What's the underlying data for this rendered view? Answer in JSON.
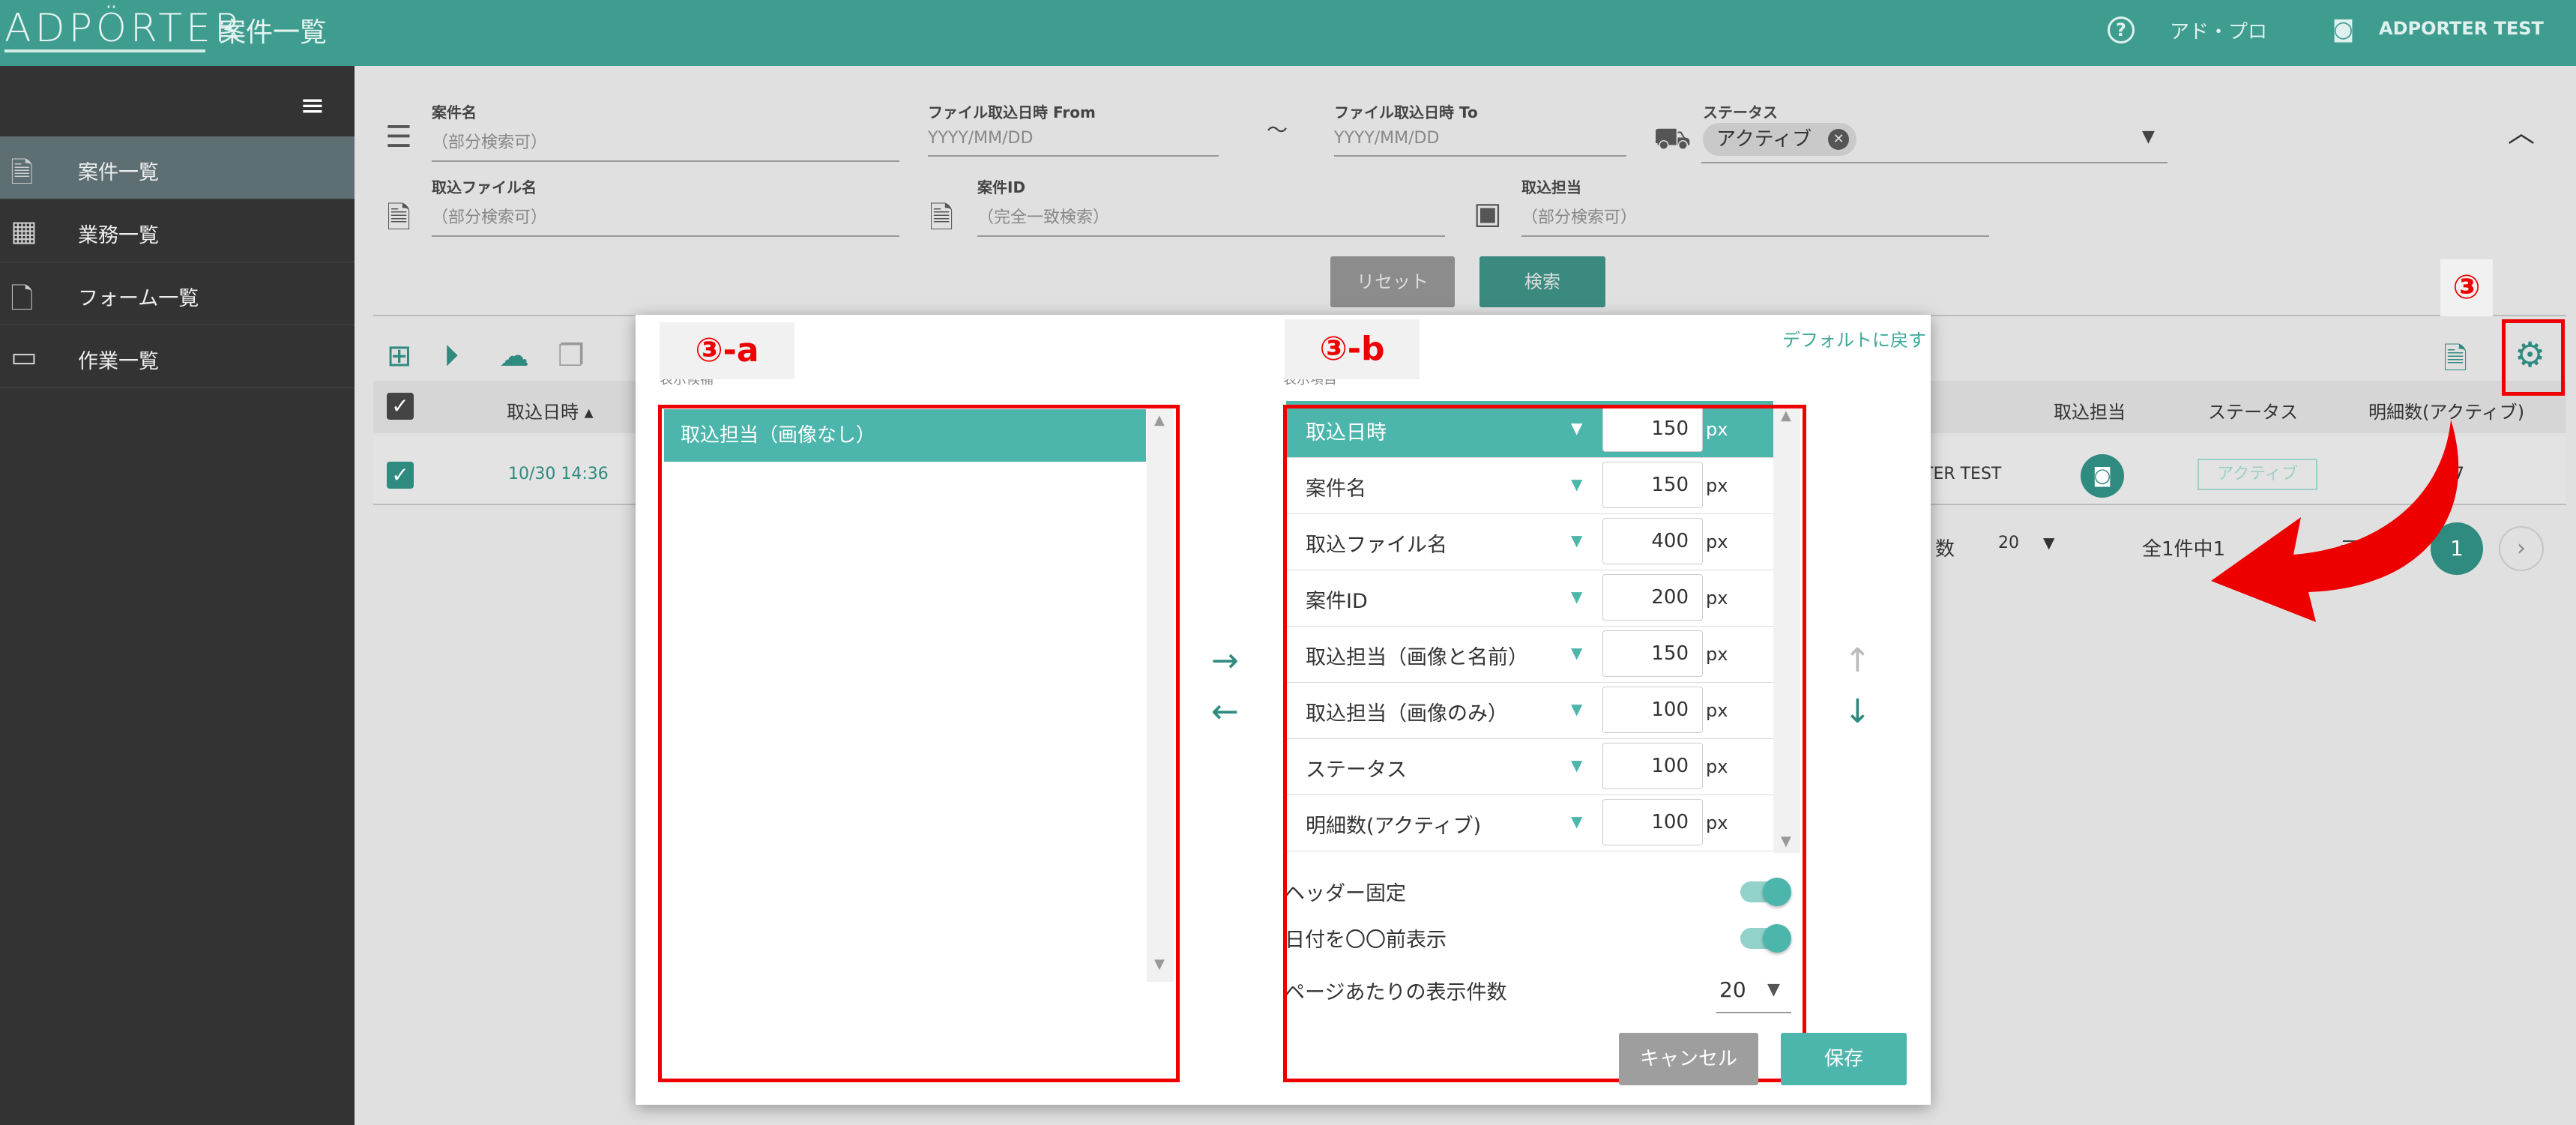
{
  "header": {
    "logo": "ADPÖRTER",
    "title": "案件一覧",
    "org_name": "アド・プロ",
    "user_name": "ADPORTER TEST",
    "help_icon": "help-circle-icon",
    "user_icon": "robot-icon"
  },
  "sidebar": {
    "items": [
      {
        "label": "案件一覧",
        "icon": "document-icon",
        "active": true
      },
      {
        "label": "業務一覧",
        "icon": "building-icon",
        "active": false
      },
      {
        "label": "フォーム一覧",
        "icon": "form-file-icon",
        "active": false
      },
      {
        "label": "作業一覧",
        "icon": "monitor-icon",
        "active": false
      }
    ]
  },
  "search": {
    "case_name_label": "案件名",
    "case_name_placeholder": "（部分検索可）",
    "date_from_label": "ファイル取込日時 From",
    "date_from_placeholder": "YYYY/MM/DD",
    "range_sep": "〜",
    "date_to_label": "ファイル取込日時 To",
    "date_to_placeholder": "YYYY/MM/DD",
    "status_label": "ステータス",
    "status_value": "アクティブ",
    "file_name_label": "取込ファイル名",
    "file_name_placeholder": "（部分検索可）",
    "case_id_label": "案件ID",
    "case_id_placeholder": "（完全一致検索）",
    "assignee_label": "取込担当",
    "assignee_placeholder": "（部分検索可）",
    "reset_label": "リセット",
    "search_label": "検索"
  },
  "table": {
    "headers": {
      "date": "取込日時",
      "assignee": "取込担当",
      "status": "ステータス",
      "details": "明細数(アクティブ)"
    },
    "row": {
      "date": "10/30 14:36",
      "assignee_partial": "TER TEST",
      "status": "アクティブ",
      "details": "7"
    },
    "pager": {
      "per_page_label_partial": "数",
      "per_page": "20",
      "summary_partial": "全1件中1",
      "summary_tail": "示",
      "current_page": "1"
    }
  },
  "annotations": {
    "main": "③",
    "a": "③-a",
    "b": "③-b",
    "color": "#e00000"
  },
  "modal": {
    "reset_default": "デフォルトに戻す",
    "left_caption": "表示候補",
    "right_caption": "表示項目",
    "available": [
      "取込担当（画像なし）"
    ],
    "columns": [
      {
        "name": "取込日時",
        "width": "150",
        "unit": "px"
      },
      {
        "name": "案件名",
        "width": "150",
        "unit": "px"
      },
      {
        "name": "取込ファイル名",
        "width": "400",
        "unit": "px"
      },
      {
        "name": "案件ID",
        "width": "200",
        "unit": "px"
      },
      {
        "name": "取込担当（画像と名前）",
        "width": "150",
        "unit": "px"
      },
      {
        "name": "取込担当（画像のみ）",
        "width": "100",
        "unit": "px"
      },
      {
        "name": "ステータス",
        "width": "100",
        "unit": "px"
      },
      {
        "name": "明細数(アクティブ)",
        "width": "100",
        "unit": "px"
      }
    ],
    "header_fixed_label": "ヘッダー固定",
    "header_fixed": true,
    "relative_date_label": "日付を〇〇前表示",
    "relative_date": true,
    "per_page_label": "ページあたりの表示件数",
    "per_page_value": "20",
    "cancel_label": "キャンセル",
    "save_label": "保存"
  }
}
